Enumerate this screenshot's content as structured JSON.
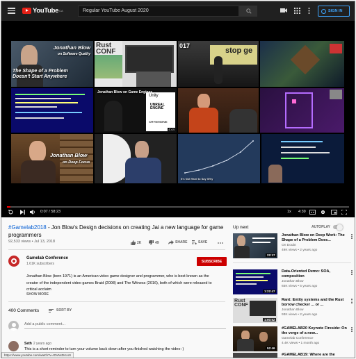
{
  "header": {
    "logo_text": "YouTube",
    "logo_sup": "CA",
    "search_value": "Regular YouTube August 2020",
    "signin_label": "SIGN IN"
  },
  "player": {
    "tiles": [
      {
        "label_lines": [
          "Jonathan Blow",
          "on Software Quality"
        ],
        "bottom_lines": [
          "The Shape of a Problem",
          "Doesn't Start Anywhere"
        ]
      },
      {
        "label_lines": [
          "Rust",
          "CONF"
        ]
      },
      {
        "label_lines": [
          "017"
        ]
      },
      {
        "label_lines": [
          "stop ge"
        ]
      },
      {
        "label_lines": []
      },
      {
        "label_lines": []
      },
      {
        "label_lines": [
          "Jonathan Blow on Game Engines"
        ],
        "bottom_lines": [
          "Unity",
          "UNREAL",
          "ENGINE",
          "CRYENGINE"
        ],
        "duration": "4:44"
      },
      {
        "label_lines": []
      },
      {
        "label_lines": []
      },
      {
        "label_lines": [
          "Jonathan Blow",
          "on Deep Focus"
        ]
      },
      {
        "label_lines": []
      },
      {
        "label_lines": [
          "It's Not Hard to Say Why"
        ]
      },
      {
        "label_lines": []
      }
    ],
    "progress": 0.01,
    "time_current": "0:07",
    "time_total": "58:23",
    "quality_label": "1x",
    "extra_time": "4:39"
  },
  "video": {
    "hashtag": "#Gamelab2018",
    "title_rest": " - Jon Blow's Design decisions on creating Jai a new language for game programmers",
    "views_date": "92,533 views • Jul 13, 2018",
    "likes": "2K",
    "dislikes": "49",
    "share_label": "SHARE",
    "save_label": "SAVE"
  },
  "channel": {
    "name": "Gamelab Conference",
    "subs": "1.61K subscribers",
    "subscribe_label": "SUBSCRIBE",
    "description": "Jonathan Blow (born 1971) is an American video game designer and programmer, who is best known as the creator of the independent video games Braid (2008) and The Witness (2016), both of which were released to critical acclaim",
    "show_more": "SHOW MORE"
  },
  "comments": {
    "count_label": "400 Comments",
    "sort_label": "SORT BY",
    "add_placeholder": "Add a public comment...",
    "first": {
      "author": "Seth",
      "time": "2 years ago",
      "text": "This is a short reminder to turn your volume back down after you finished watching the video :)"
    }
  },
  "statusbar": "https://www.youtube.com/watch?v=tOvNxDcLsS",
  "upnext": {
    "label": "Up next",
    "autoplay_label": "AUTOPLAY",
    "items": [
      {
        "title": "Jonathan Blow on Deep Work: The Shape of a Problem Does...",
        "channel": "On Doubt",
        "views": "49K views • 2 years ago",
        "duration": "22:17"
      },
      {
        "title": "Data-Oriented Demo: SOA, composition",
        "channel": "Jonathan Blow",
        "views": "65K views • 5 years ago",
        "duration": "1:22:47"
      },
      {
        "title": "Rant: Entity systems and the Rust borrow checker ... or ...",
        "channel": "Jonathan Blow",
        "views": "93K views • 2 years ago",
        "duration": "1:00:52"
      },
      {
        "title": "#GAMELAB20 Keynote Fireside: On the verge of a new...",
        "channel": "Gamelab Conference",
        "views": "4.4K views • 1 month ago",
        "duration": "52:46"
      },
      {
        "title": "#GAMELAB19: Where are the",
        "channel": "",
        "views": "",
        "duration": ""
      }
    ]
  }
}
